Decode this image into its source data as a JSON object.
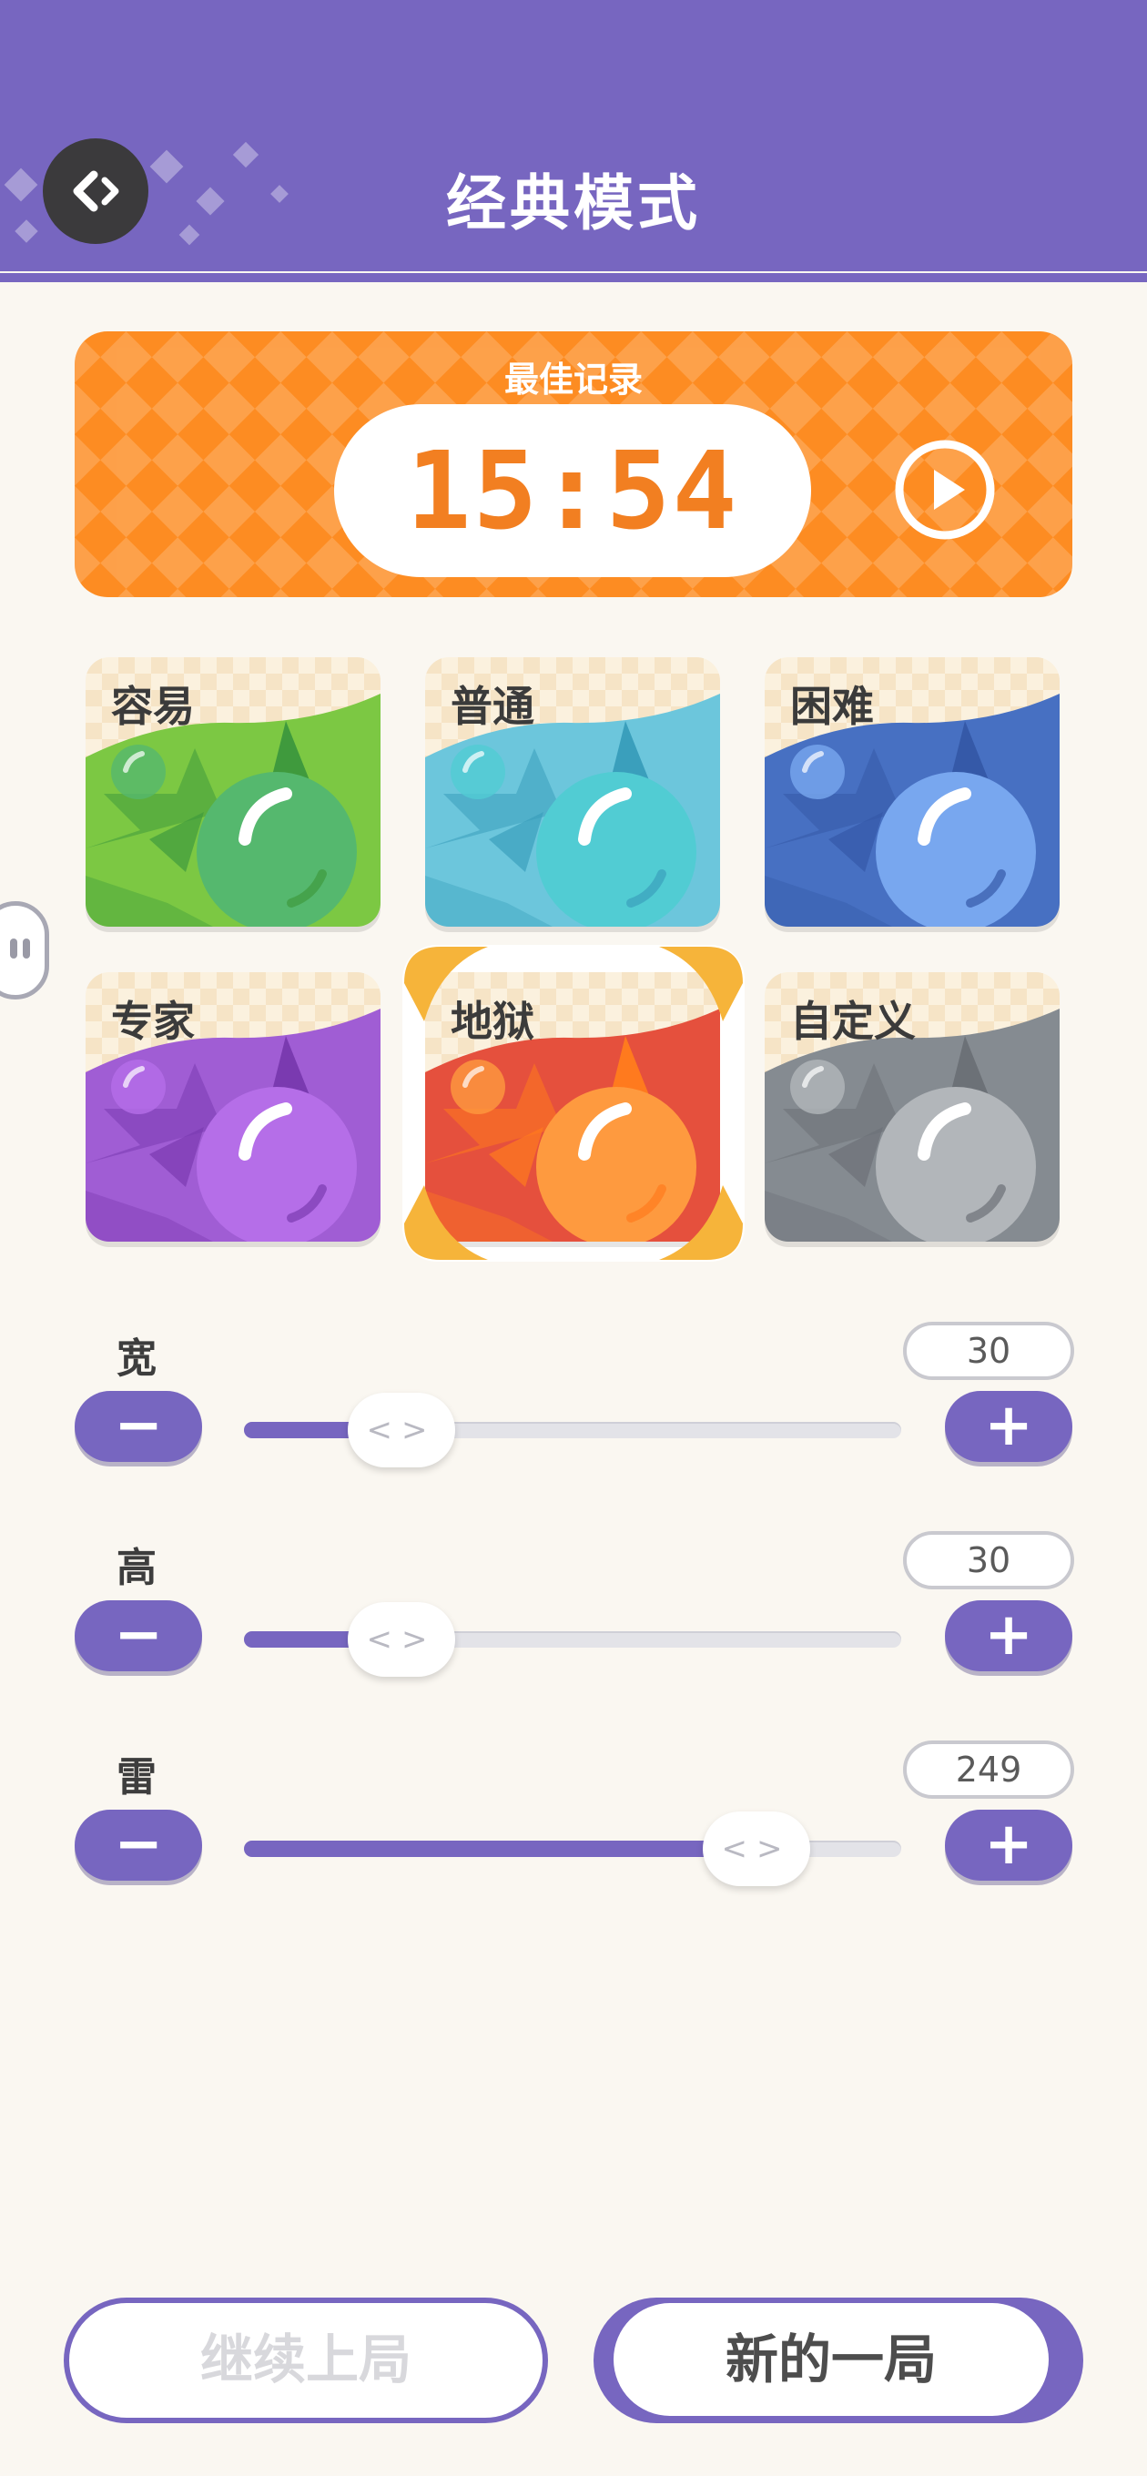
{
  "header": {
    "title": "经典模式",
    "back_icon": "back-arrow-icon",
    "color": "#7766c0"
  },
  "best_record": {
    "label": "最佳记录",
    "time": "15:54",
    "color": "#fd8c22"
  },
  "difficulties": [
    {
      "label": "容易",
      "colors": [
        "#7cc843",
        "#55b86e",
        "#3f9a3d"
      ],
      "selected": false
    },
    {
      "label": "普通",
      "colors": [
        "#6cc6dc",
        "#51ccd3",
        "#3a9fbc"
      ],
      "selected": false
    },
    {
      "label": "困难",
      "colors": [
        "#4770c2",
        "#78a7ef",
        "#3559a8"
      ],
      "selected": false
    },
    {
      "label": "专家",
      "colors": [
        "#a05dd4",
        "#b56ee8",
        "#7a3ab0"
      ],
      "selected": false
    },
    {
      "label": "地狱",
      "colors": [
        "#e5503d",
        "#fe9a3f",
        "#ff7a1e"
      ],
      "selected": true
    },
    {
      "label": "自定义",
      "colors": [
        "#858b91",
        "#b2b6ba",
        "#6c7177"
      ],
      "selected": false
    }
  ],
  "sliders": [
    {
      "label": "宽",
      "value": "30",
      "fraction": 0.24
    },
    {
      "label": "高",
      "value": "30",
      "fraction": 0.24
    },
    {
      "label": "雷",
      "value": "249",
      "fraction": 0.78
    }
  ],
  "controls": {
    "minus": "−",
    "plus": "+",
    "thumb": "<>"
  },
  "buttons": {
    "continue": "继续上局",
    "new_game": "新的一局"
  }
}
